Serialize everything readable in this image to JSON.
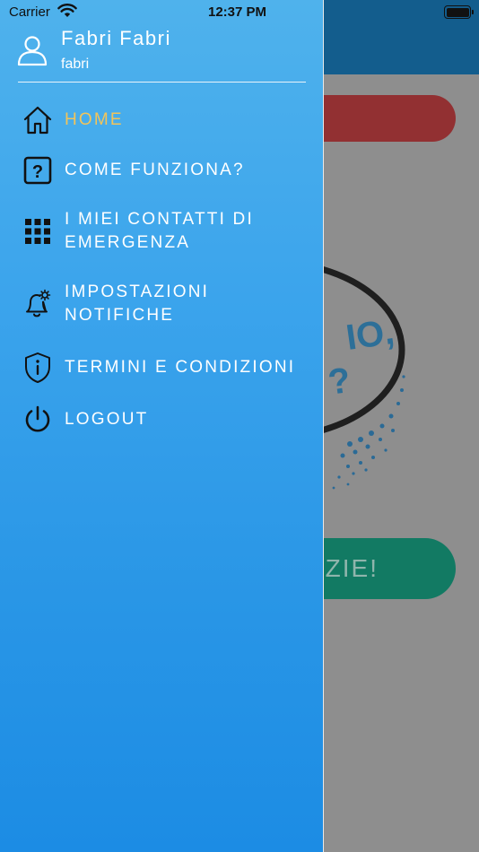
{
  "status_bar": {
    "carrier": "Carrier",
    "time": "12:37 PM"
  },
  "profile": {
    "name": "Fabri Fabri",
    "username": "fabri"
  },
  "menu": {
    "items": [
      {
        "label": "HOME",
        "icon": "home-icon",
        "active": true
      },
      {
        "label": "COME FUNZIONA?",
        "icon": "question-icon",
        "active": false
      },
      {
        "label": "I MIEI CONTATTI DI EMERGENZA",
        "icon": "grid-icon",
        "active": false
      },
      {
        "label": "IMPOSTAZIONI NOTIFICHE",
        "icon": "bell-settings-icon",
        "active": false
      },
      {
        "label": "TERMINI E CONDIZIONI",
        "icon": "shield-info-icon",
        "active": false
      },
      {
        "label": "LOGOUT",
        "icon": "power-icon",
        "active": false
      }
    ]
  },
  "background": {
    "green_button_label": "ZIE!",
    "illustration_text": "IO, ?"
  },
  "colors": {
    "drawer_top": "#4fb2ec",
    "drawer_bottom": "#1c8ce4",
    "active_label": "#f2c45a",
    "bg_header": "#135d8d",
    "bg_red": "#923032",
    "bg_green": "#127a63"
  }
}
